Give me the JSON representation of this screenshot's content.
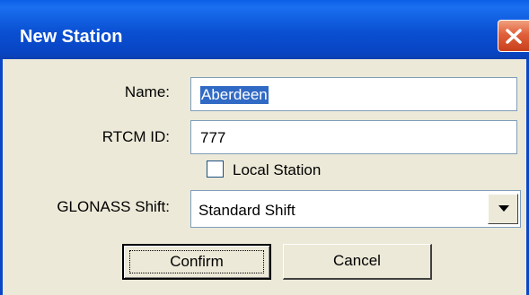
{
  "window": {
    "title": "New Station"
  },
  "form": {
    "name_label": "Name:",
    "name_value": "Aberdeen",
    "rtcm_label": "RTCM ID:",
    "rtcm_value": "777",
    "local_station_label": "Local Station",
    "local_station_checked": false,
    "glonass_label": "GLONASS Shift:",
    "glonass_value": "Standard Shift"
  },
  "buttons": {
    "confirm": "Confirm",
    "cancel": "Cancel"
  },
  "icons": {
    "close": "close-icon",
    "dropdown": "chevron-down-icon"
  },
  "colors": {
    "titlebar": "#0a4fd2",
    "close": "#e0603a",
    "dialog_bg": "#ece9d8",
    "selection": "#316ac5"
  }
}
